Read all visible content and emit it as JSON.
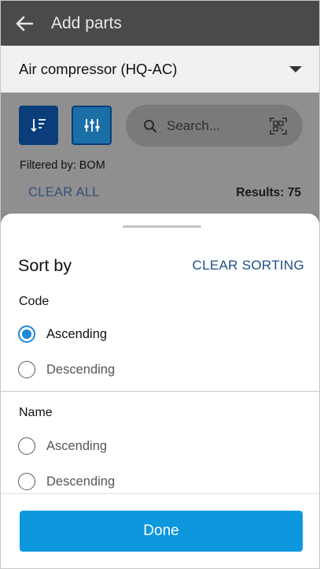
{
  "appbar": {
    "title": "Add parts",
    "back_icon": "arrow-left-icon"
  },
  "selector": {
    "value": "Air compressor (HQ-AC)"
  },
  "toolbar": {
    "search_placeholder": "Search...",
    "filtered_by": "Filtered by: BOM",
    "clear_all": "CLEAR ALL",
    "results": "Results: 75"
  },
  "sheet": {
    "title": "Sort by",
    "clear_sorting": "CLEAR SORTING",
    "groups": [
      {
        "title": "Code",
        "options": [
          {
            "label": "Ascending",
            "checked": true
          },
          {
            "label": "Descending",
            "checked": false
          }
        ]
      },
      {
        "title": "Name",
        "options": [
          {
            "label": "Ascending",
            "checked": false
          },
          {
            "label": "Descending",
            "checked": false
          }
        ]
      }
    ],
    "done_label": "Done"
  },
  "colors": {
    "appbar": "#4a4a4a",
    "primary_button": "#0d97dc",
    "accent_link": "#1d4f86",
    "radio_selected": "#1e88d8"
  }
}
